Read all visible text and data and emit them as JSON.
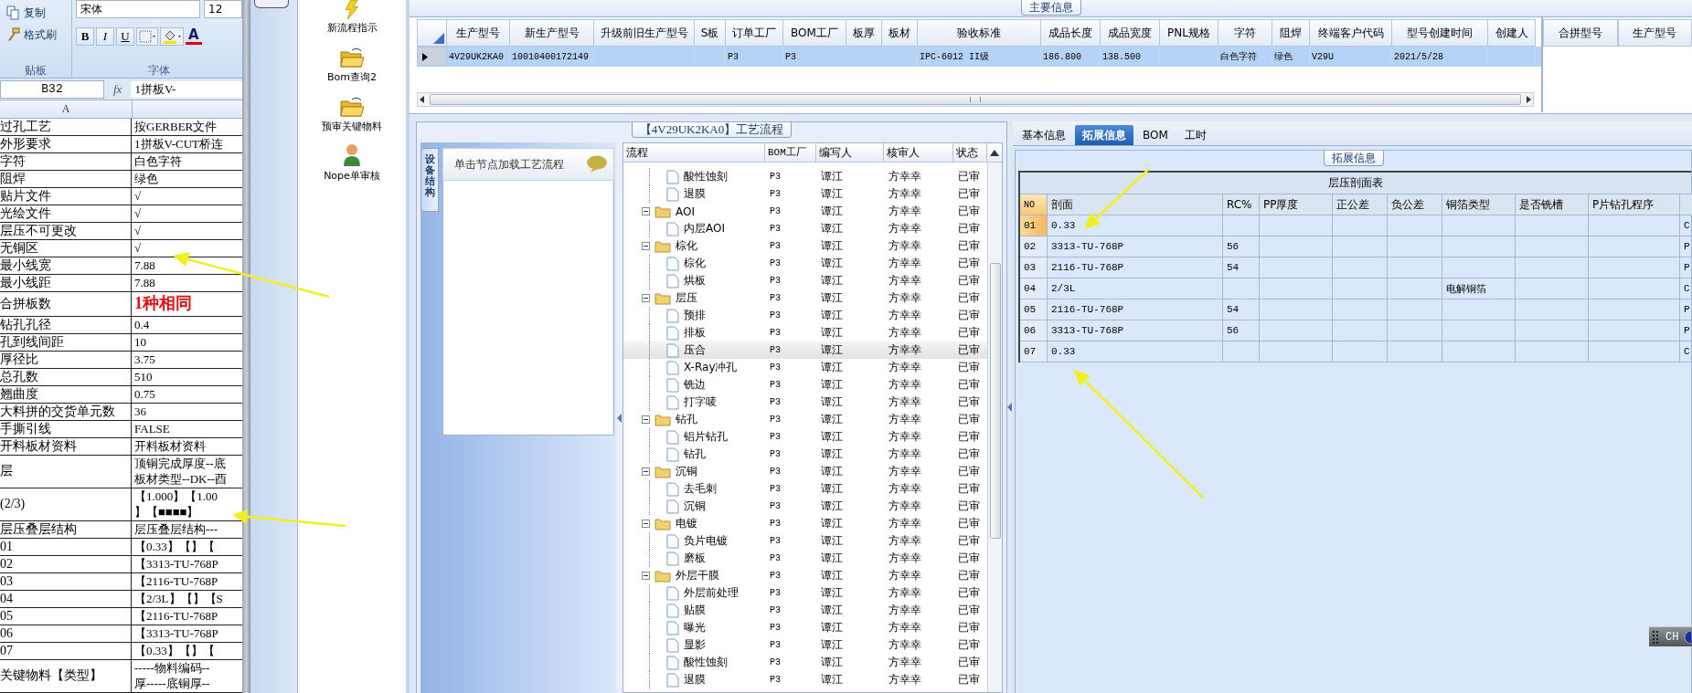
{
  "excel": {
    "clipboard": {
      "copy": "复制",
      "format_painter": "格式刷",
      "group": "贴板"
    },
    "font": {
      "name": "宋体",
      "size": "12",
      "bold": "B",
      "italic": "I",
      "underline": "U",
      "font_color": "A",
      "group": "字体"
    },
    "name_box": "B32",
    "fx": "fx",
    "formula": "1拼板V-",
    "column_a": "A",
    "rows": [
      {
        "label": "过孔工艺",
        "value": "按GERBER文件",
        "emphasis": false
      },
      {
        "label": "外形要求",
        "value": "1拼板V-CUT桥连",
        "emphasis": false
      },
      {
        "label": "字符",
        "value": "白色字符",
        "emphasis": false
      },
      {
        "label": "阻焊",
        "value": "绿色",
        "emphasis": false
      },
      {
        "label": "贴片文件",
        "value": "√",
        "emphasis": false
      },
      {
        "label": "光绘文件",
        "value": "√",
        "emphasis": false
      },
      {
        "label": "层压不可更改",
        "value": "√",
        "emphasis": false
      },
      {
        "label": "无铜区",
        "value": "√",
        "emphasis": false
      },
      {
        "label": "最小线宽",
        "value": "7.88",
        "emphasis": false
      },
      {
        "label": "最小线距",
        "value": "7.88",
        "emphasis": false
      },
      {
        "label": "合拼板数",
        "value": "1种相同",
        "emphasis": true
      },
      {
        "label": "钻孔孔径",
        "value": "0.4",
        "emphasis": false
      },
      {
        "label": "孔到线间距",
        "value": "10",
        "emphasis": false
      },
      {
        "label": "厚径比",
        "value": "3.75",
        "emphasis": false
      },
      {
        "label": "总孔数",
        "value": "510",
        "emphasis": false
      },
      {
        "label": "翘曲度",
        "value": "0.75",
        "emphasis": false
      },
      {
        "label": "大料拼的交货单元数",
        "value": "36",
        "emphasis": false
      },
      {
        "label": "手撕引线",
        "value": "FALSE",
        "emphasis": false
      },
      {
        "label": "开料板材资料",
        "value": "开料板材资料",
        "emphasis": false
      },
      {
        "label": "层",
        "value": "顶铜完成厚度--底",
        "value_line_2": "板材类型--DK--酉",
        "emphasis": false
      },
      {
        "label": "(2/3)",
        "value": "【1.000】【1.00",
        "value_line_2": "】【■■■■】",
        "emphasis": false
      },
      {
        "label": "层压叠层结构",
        "value": "层压叠层结构---",
        "emphasis": false
      },
      {
        "label": "01",
        "value": "【0.33】【】【",
        "emphasis": false
      },
      {
        "label": "02",
        "value": "【3313-TU-768P",
        "emphasis": false
      },
      {
        "label": "03",
        "value": "【2116-TU-768P",
        "emphasis": false
      },
      {
        "label": "04",
        "value": "【2/3L】【】【S",
        "emphasis": false
      },
      {
        "label": "05",
        "value": "【2116-TU-768P",
        "emphasis": false
      },
      {
        "label": "06",
        "value": "【3313-TU-768P",
        "emphasis": false
      },
      {
        "label": "07",
        "value": "【0.33】【】【",
        "emphasis": false
      },
      {
        "label": "关键物料【类型】",
        "value": "-----物料编码--",
        "value_line_2": "厚-----底铜厚--",
        "emphasis": false
      }
    ]
  },
  "nav": [
    {
      "label": "新流程指示",
      "kind": "lightning"
    },
    {
      "label": "Bom查询2",
      "kind": "folder"
    },
    {
      "label": "预审关键物料",
      "kind": "folder"
    },
    {
      "label": "Nope单审核",
      "kind": "person"
    }
  ],
  "main_table": {
    "title": "主要信息",
    "row_selected": true,
    "columns": [
      {
        "header": "生产型号",
        "value": "4V29UK2KA0"
      },
      {
        "header": "新生产型号",
        "value": "10010400172149"
      },
      {
        "header": "升级前旧生产型号"
      },
      {
        "header": "S板"
      },
      {
        "header": "订单工厂",
        "value": "P3"
      },
      {
        "header": "BOM工厂",
        "value": "P3"
      },
      {
        "header": "板厚"
      },
      {
        "header": "板材"
      },
      {
        "header": "验收标准",
        "value": "IPC-6012 II级"
      },
      {
        "header": "成品长度",
        "value": "186.800"
      },
      {
        "header": "成品宽度",
        "value": "138.500"
      },
      {
        "header": "PNL规格"
      },
      {
        "header": "字符",
        "value": "白色字符"
      },
      {
        "header": "阻焊",
        "value": "绿色"
      },
      {
        "header": "终端客户代码",
        "value": "V29U"
      },
      {
        "header": "型号创建时间",
        "value": "2021/5/28"
      },
      {
        "header": "创建人"
      }
    ]
  },
  "merge_table": {
    "columns": [
      "合拼型号",
      "生产型号"
    ]
  },
  "process": {
    "title": "【4V29UK2KA0】工艺流程",
    "side_tab": "设备结构",
    "hint": "单击节点加载工艺流程",
    "columns": [
      "流程",
      "BOM工厂",
      "编写人",
      "核审人",
      "状态"
    ],
    "groups": [
      {
        "children": [
          {
            "name": "酸性蚀刻",
            "factory": "P3",
            "writer": "谭江",
            "reviewer": "方幸幸",
            "status": "已审",
            "selected": false
          },
          {
            "name": "退膜",
            "factory": "P3",
            "writer": "谭江",
            "reviewer": "方幸幸",
            "status": "已审",
            "selected": false
          }
        ]
      },
      {
        "name": "AOI",
        "factory": "P3",
        "writer": "谭江",
        "reviewer": "方幸幸",
        "status": "已审",
        "selected": false,
        "expanded": true,
        "children": [
          {
            "name": "内层AOI",
            "factory": "P3",
            "writer": "谭江",
            "reviewer": "方幸幸",
            "status": "已审",
            "selected": false
          }
        ]
      },
      {
        "name": "棕化",
        "factory": "P3",
        "writer": "谭江",
        "reviewer": "方幸幸",
        "status": "已审",
        "selected": false,
        "expanded": true,
        "children": [
          {
            "name": "棕化",
            "factory": "P3",
            "writer": "谭江",
            "reviewer": "方幸幸",
            "status": "已审",
            "selected": false
          },
          {
            "name": "烘板",
            "factory": "P3",
            "writer": "谭江",
            "reviewer": "方幸幸",
            "status": "已审",
            "selected": false
          }
        ]
      },
      {
        "name": "层压",
        "factory": "P3",
        "writer": "谭江",
        "reviewer": "方幸幸",
        "status": "已审",
        "selected": false,
        "expanded": true,
        "children": [
          {
            "name": "预排",
            "factory": "P3",
            "writer": "谭江",
            "reviewer": "方幸幸",
            "status": "已审",
            "selected": false
          },
          {
            "name": "排板",
            "factory": "P3",
            "writer": "谭江",
            "reviewer": "方幸幸",
            "status": "已审",
            "selected": false
          },
          {
            "name": "压合",
            "factory": "P3",
            "writer": "谭江",
            "reviewer": "方幸幸",
            "status": "已审",
            "selected": true
          },
          {
            "name": "X-Ray冲孔",
            "factory": "P3",
            "writer": "谭江",
            "reviewer": "方幸幸",
            "status": "已审",
            "selected": false
          },
          {
            "name": "铣边",
            "factory": "P3",
            "writer": "谭江",
            "reviewer": "方幸幸",
            "status": "已审",
            "selected": false
          },
          {
            "name": "打字唛",
            "factory": "P3",
            "writer": "谭江",
            "reviewer": "方幸幸",
            "status": "已审",
            "selected": false
          }
        ]
      },
      {
        "name": "钻孔",
        "factory": "P3",
        "writer": "谭江",
        "reviewer": "方幸幸",
        "status": "已审",
        "selected": false,
        "expanded": true,
        "children": [
          {
            "name": "铝片钻孔",
            "factory": "P3",
            "writer": "谭江",
            "reviewer": "方幸幸",
            "status": "已审",
            "selected": false
          },
          {
            "name": "钻孔",
            "factory": "P3",
            "writer": "谭江",
            "reviewer": "方幸幸",
            "status": "已审",
            "selected": false
          }
        ]
      },
      {
        "name": "沉铜",
        "factory": "P3",
        "writer": "谭江",
        "reviewer": "方幸幸",
        "status": "已审",
        "selected": false,
        "expanded": true,
        "children": [
          {
            "name": "去毛刺",
            "factory": "P3",
            "writer": "谭江",
            "reviewer": "方幸幸",
            "status": "已审",
            "selected": false
          },
          {
            "name": "沉铜",
            "factory": "P3",
            "writer": "谭江",
            "reviewer": "方幸幸",
            "status": "已审",
            "selected": false
          }
        ]
      },
      {
        "name": "电镀",
        "factory": "P3",
        "writer": "谭江",
        "reviewer": "方幸幸",
        "status": "已审",
        "selected": false,
        "expanded": true,
        "children": [
          {
            "name": "负片电镀",
            "factory": "P3",
            "writer": "谭江",
            "reviewer": "方幸幸",
            "status": "已审",
            "selected": false
          },
          {
            "name": "磨板",
            "factory": "P3",
            "writer": "谭江",
            "reviewer": "方幸幸",
            "status": "已审",
            "selected": false
          }
        ]
      },
      {
        "name": "外层干膜",
        "factory": "P3",
        "writer": "谭江",
        "reviewer": "方幸幸",
        "status": "已审",
        "selected": false,
        "expanded": true,
        "children": [
          {
            "name": "外层前处理",
            "factory": "P3",
            "writer": "谭江",
            "reviewer": "方幸幸",
            "status": "已审",
            "selected": false
          },
          {
            "name": "贴膜",
            "factory": "P3",
            "writer": "谭江",
            "reviewer": "方幸幸",
            "status": "已审",
            "selected": false
          },
          {
            "name": "曝光",
            "factory": "P3",
            "writer": "谭江",
            "reviewer": "方幸幸",
            "status": "已审",
            "selected": false
          },
          {
            "name": "显影",
            "factory": "P3",
            "writer": "谭江",
            "reviewer": "方幸幸",
            "status": "已审",
            "selected": false
          },
          {
            "name": "酸性蚀刻",
            "factory": "P3",
            "writer": "谭江",
            "reviewer": "方幸幸",
            "status": "已审",
            "selected": false
          },
          {
            "name": "退膜",
            "factory": "P3",
            "writer": "谭江",
            "reviewer": "方幸幸",
            "status": "已审",
            "selected": false
          }
        ]
      }
    ]
  },
  "detail": {
    "tabs": [
      {
        "label": "基本信息",
        "selected": false
      },
      {
        "label": "拓展信息",
        "selected": true
      },
      {
        "label": "BOM",
        "selected": false
      },
      {
        "label": "工时",
        "selected": false
      }
    ],
    "group_title": "拓展信息",
    "table": {
      "title": "层压剖面表",
      "columns": [
        "NO",
        "剖面",
        "RC%",
        "PP厚度",
        "正公差",
        "负公差",
        "铜箔类型",
        "是否铣槽",
        "P片钻孔程序"
      ],
      "rows": [
        {
          "no": "01",
          "section": "0.33",
          "column_10": "C",
          "selected": true
        },
        {
          "no": "02",
          "section": "3313-TU-768P",
          "rc": "56",
          "column_10": "P",
          "selected": false
        },
        {
          "no": "03",
          "section": "2116-TU-768P",
          "rc": "54",
          "column_10": "P",
          "selected": false
        },
        {
          "no": "04",
          "section": "2/3L",
          "foil_type": "电解铜箔",
          "column_10": "C",
          "selected": false
        },
        {
          "no": "05",
          "section": "2116-TU-768P",
          "rc": "54",
          "column_10": "P",
          "selected": false
        },
        {
          "no": "06",
          "section": "3313-TU-768P",
          "rc": "56",
          "column_10": "P",
          "selected": false
        },
        {
          "no": "07",
          "section": "0.33",
          "column_10": "C",
          "selected": false
        }
      ]
    }
  },
  "ime_bar": {
    "language": "CH"
  }
}
